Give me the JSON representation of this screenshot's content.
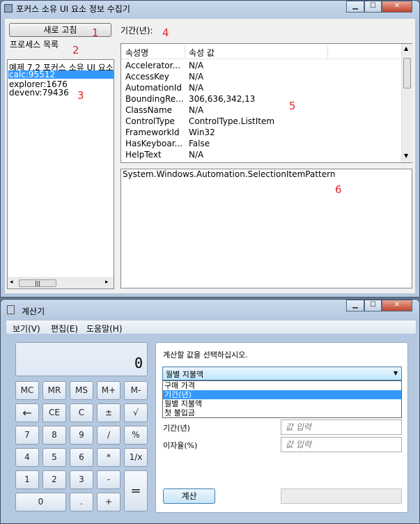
{
  "top_window": {
    "title": "포커스 소유 UI 요소 정보 수집기",
    "refresh_button": "새로 고침",
    "period_label": "기간(년):",
    "process_label": "프로세스 목록",
    "processes": [
      "예제 7.2 포커스 소유 UI 요소",
      "calc:95512",
      "explorer:1676",
      "devenv:79436"
    ],
    "selected_process_index": 1,
    "hscroll_thumb": "|||",
    "columns": [
      "속성명",
      "속성 값"
    ],
    "properties": [
      {
        "name": "Accelerator...",
        "value": "N/A"
      },
      {
        "name": "AccessKey",
        "value": "N/A"
      },
      {
        "name": "AutomationId",
        "value": "N/A"
      },
      {
        "name": "BoundingRe...",
        "value": "306,636,342,13"
      },
      {
        "name": "ClassName",
        "value": "N/A"
      },
      {
        "name": "ControlType",
        "value": "ControlType.ListItem"
      },
      {
        "name": "FrameworkId",
        "value": "Win32"
      },
      {
        "name": "HasKeyboar...",
        "value": "False"
      },
      {
        "name": "HelpText",
        "value": "N/A"
      }
    ],
    "pattern_text": "System.Windows.Automation.SelectionItemPattern",
    "annotations": [
      "1",
      "2",
      "3",
      "4",
      "5",
      "6"
    ]
  },
  "calc_window": {
    "title": "계산기",
    "menu": [
      "보기(V)",
      "편집(E)",
      "도움말(H)"
    ],
    "display_value": "0",
    "memory_buttons": [
      "MC",
      "MR",
      "MS",
      "M+",
      "M-"
    ],
    "row2": [
      "←",
      "CE",
      "C",
      "±",
      "√"
    ],
    "row3": [
      "7",
      "8",
      "9",
      "/",
      "%"
    ],
    "row4": [
      "4",
      "5",
      "6",
      "*",
      "1/x"
    ],
    "row5": [
      "1",
      "2",
      "3",
      "-",
      "="
    ],
    "row6": [
      "0",
      ".",
      "+"
    ],
    "panel": {
      "prompt": "계산할 값을 선택하십시오.",
      "selected": "월별 지불액",
      "options": [
        "구매 가격",
        "기간(년)",
        "월별 지불액",
        "첫 불입금"
      ],
      "highlighted_option_index": 1,
      "period_label": "기간(년)",
      "rate_label": "이자율(%)",
      "input_placeholder": "값 입력",
      "calculate_button": "계산"
    }
  },
  "colors": {
    "annotation": "#e0242b",
    "selection": "#3399ff"
  }
}
